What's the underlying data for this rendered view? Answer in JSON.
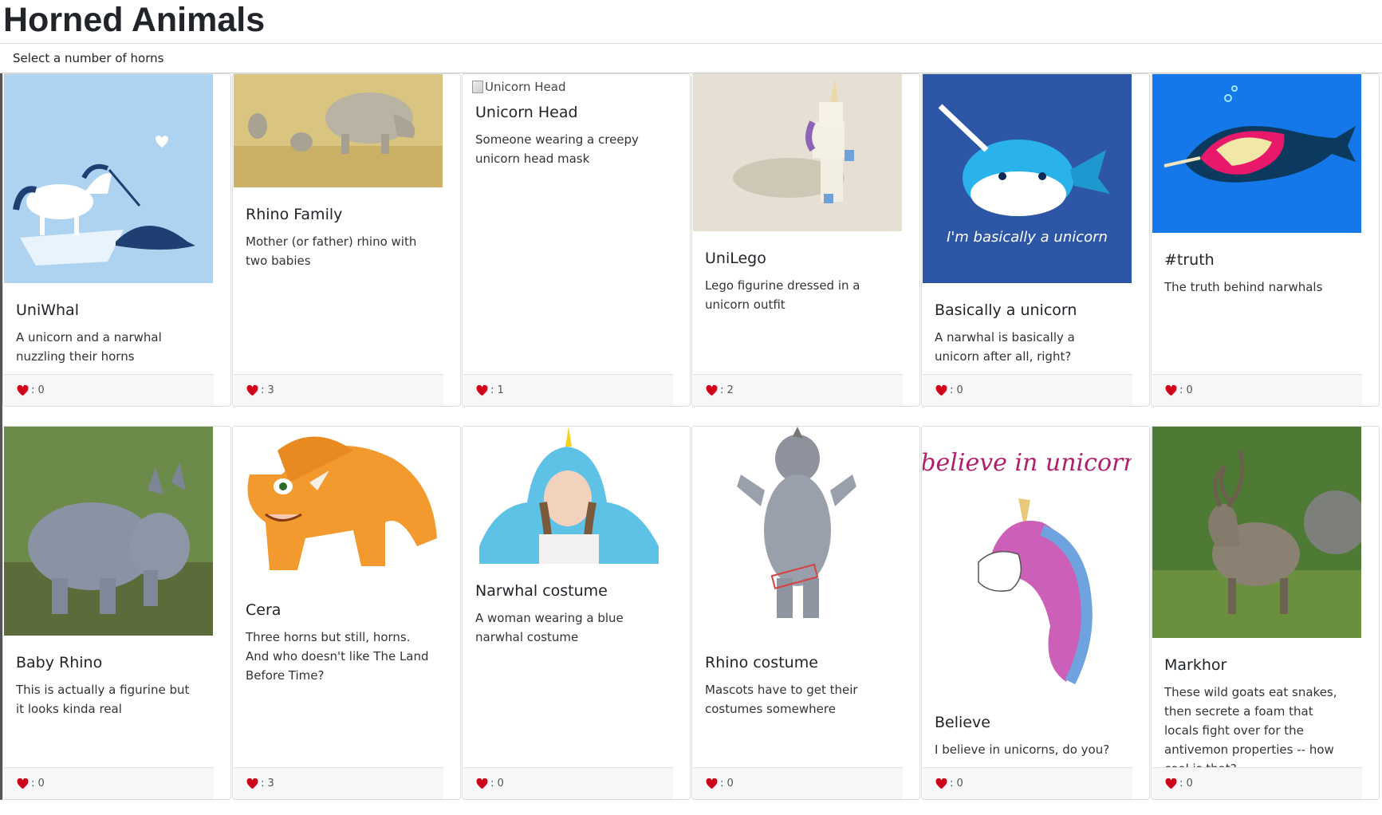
{
  "header": {
    "title": "Horned Animals"
  },
  "filter": {
    "label": "Select a number of horns"
  },
  "cards": [
    {
      "title": "UniWhal",
      "description": "A unicorn and a narwhal nuzzling their horns",
      "likes": ": 0",
      "image": "unicorn-narwhal-illustration"
    },
    {
      "title": "Rhino Family",
      "description": "Mother (or father) rhino with two babies",
      "likes": ": 3",
      "image": "rhino-family-photo"
    },
    {
      "title": "Unicorn Head",
      "description": "Someone wearing a creepy unicorn head mask",
      "likes": ": 1",
      "image": "broken-image",
      "alt": "Unicorn Head"
    },
    {
      "title": "UniLego",
      "description": "Lego figurine dressed in a unicorn outfit",
      "likes": ": 2",
      "image": "lego-unicorn-photo"
    },
    {
      "title": "Basically a unicorn",
      "description": "A narwhal is basically a unicorn after all, right?",
      "likes": ": 0",
      "image": "narwhal-cartoon",
      "image_caption": "I'm basically a unicorn"
    },
    {
      "title": "#truth",
      "description": "The truth behind narwhals",
      "likes": ": 0",
      "image": "narwhal-truth-illustration"
    },
    {
      "title": "Baby Rhino",
      "description": "This is actually a figurine but it looks kinda real",
      "likes": ": 0",
      "image": "baby-rhino-photo"
    },
    {
      "title": "Cera",
      "description": "Three horns but still, horns. And who doesn't like The Land Before Time?",
      "likes": ": 3",
      "image": "triceratops-cartoon"
    },
    {
      "title": "Narwhal costume",
      "description": "A woman wearing a blue narwhal costume",
      "likes": ": 0",
      "image": "narwhal-costume-photo"
    },
    {
      "title": "Rhino costume",
      "description": "Mascots have to get their costumes somewhere",
      "likes": ": 0",
      "image": "rhino-mascot-photo"
    },
    {
      "title": "Believe",
      "description": "I believe in unicorns, do you?",
      "likes": ": 0",
      "image": "unicorn-watercolor",
      "image_caption": "I believe in unicorns"
    },
    {
      "title": "Markhor",
      "description": "These wild goats eat snakes, then secrete a foam that locals fight over for the antivemon properties -- how cool is that?",
      "likes": ": 0",
      "image": "markhor-goat-photo"
    }
  ],
  "colors": {
    "heart": "#d0021b",
    "footer_bg": "#f7f7f7",
    "border": "#dcdcdc"
  }
}
